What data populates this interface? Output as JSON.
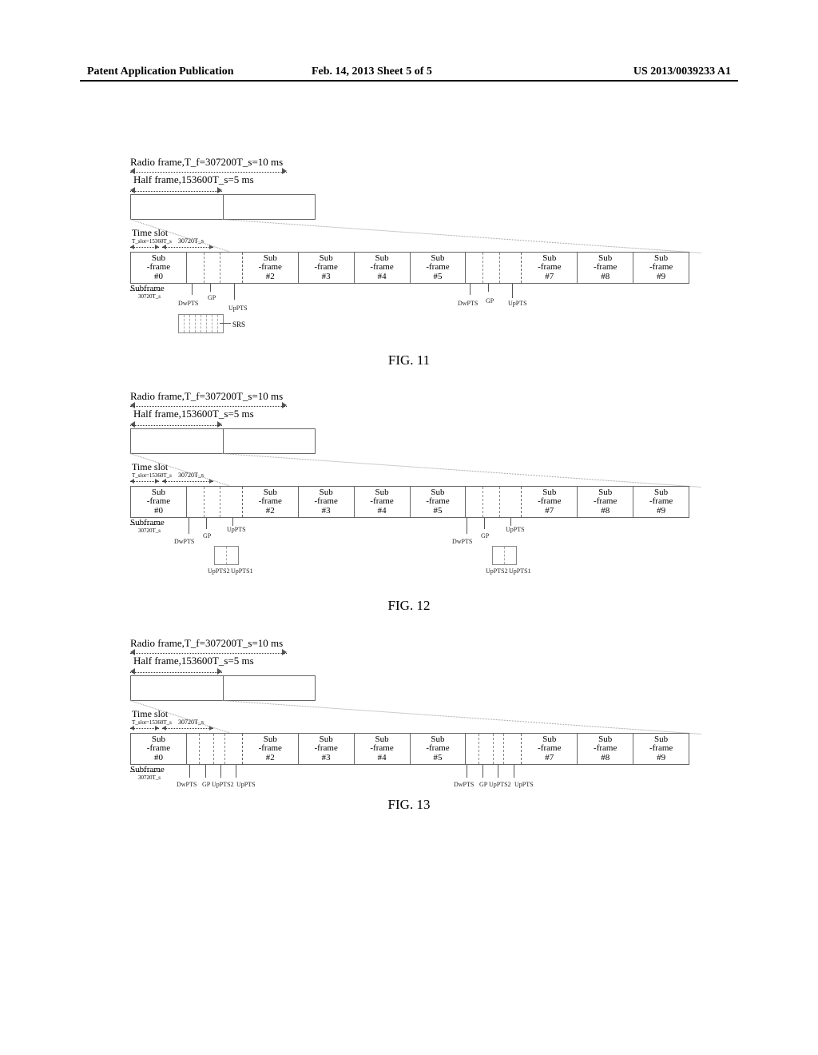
{
  "header": {
    "left": "Patent Application Publication",
    "center": "Feb. 14, 2013  Sheet 5 of 5",
    "right": "US 2013/0039233 A1"
  },
  "common_labels": {
    "radio_frame": "Radio frame,T_f=307200T_s=10 ms",
    "half_frame": "Half frame,153600T_s=5 ms",
    "time_slot": "Time slot",
    "time_slot_formula": "T_slot=15360T_s",
    "thirty_k": "30720T_s",
    "subframe": "Subframe",
    "subframe_formula": "30720T_s",
    "dwpts": "DwPTS",
    "gp": "GP",
    "uppts": "UpPTS",
    "uppts1": "UpPTS1",
    "uppts2": "UpPTS2",
    "srs": "SRS"
  },
  "subframes": [
    {
      "label": "Sub\n-frame\n#0",
      "type": "normal"
    },
    {
      "label": "",
      "type": "special"
    },
    {
      "label": "Sub\n-frame\n#2",
      "type": "normal"
    },
    {
      "label": "Sub\n-frame\n#3",
      "type": "normal"
    },
    {
      "label": "Sub\n-frame\n#4",
      "type": "normal"
    },
    {
      "label": "Sub\n-frame\n#5",
      "type": "normal"
    },
    {
      "label": "",
      "type": "special"
    },
    {
      "label": "Sub\n-frame\n#7",
      "type": "normal"
    },
    {
      "label": "Sub\n-frame\n#8",
      "type": "normal"
    },
    {
      "label": "Sub\n-frame\n#9",
      "type": "normal"
    }
  ],
  "figures": {
    "fig11": {
      "caption": "FIG. 11"
    },
    "fig12": {
      "caption": "FIG. 12"
    },
    "fig13": {
      "caption": "FIG. 13"
    }
  }
}
